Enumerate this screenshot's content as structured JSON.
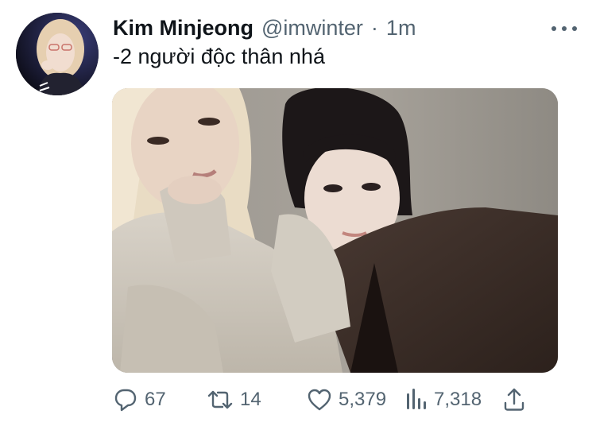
{
  "tweet": {
    "author_name": "Kim Minjeong",
    "handle": "@imwinter",
    "separator": "·",
    "timestamp": "1m",
    "text": "-2 người độc thân nhá"
  },
  "actions": {
    "replies": "67",
    "retweets": "14",
    "likes": "5,379",
    "views": "7,318"
  },
  "icons": {
    "reply": "speech-bubble-icon",
    "retweet": "retweet-arrows-icon",
    "like": "heart-icon",
    "views": "bar-chart-icon",
    "share": "upload-share-icon",
    "more": "three-dots-icon"
  }
}
